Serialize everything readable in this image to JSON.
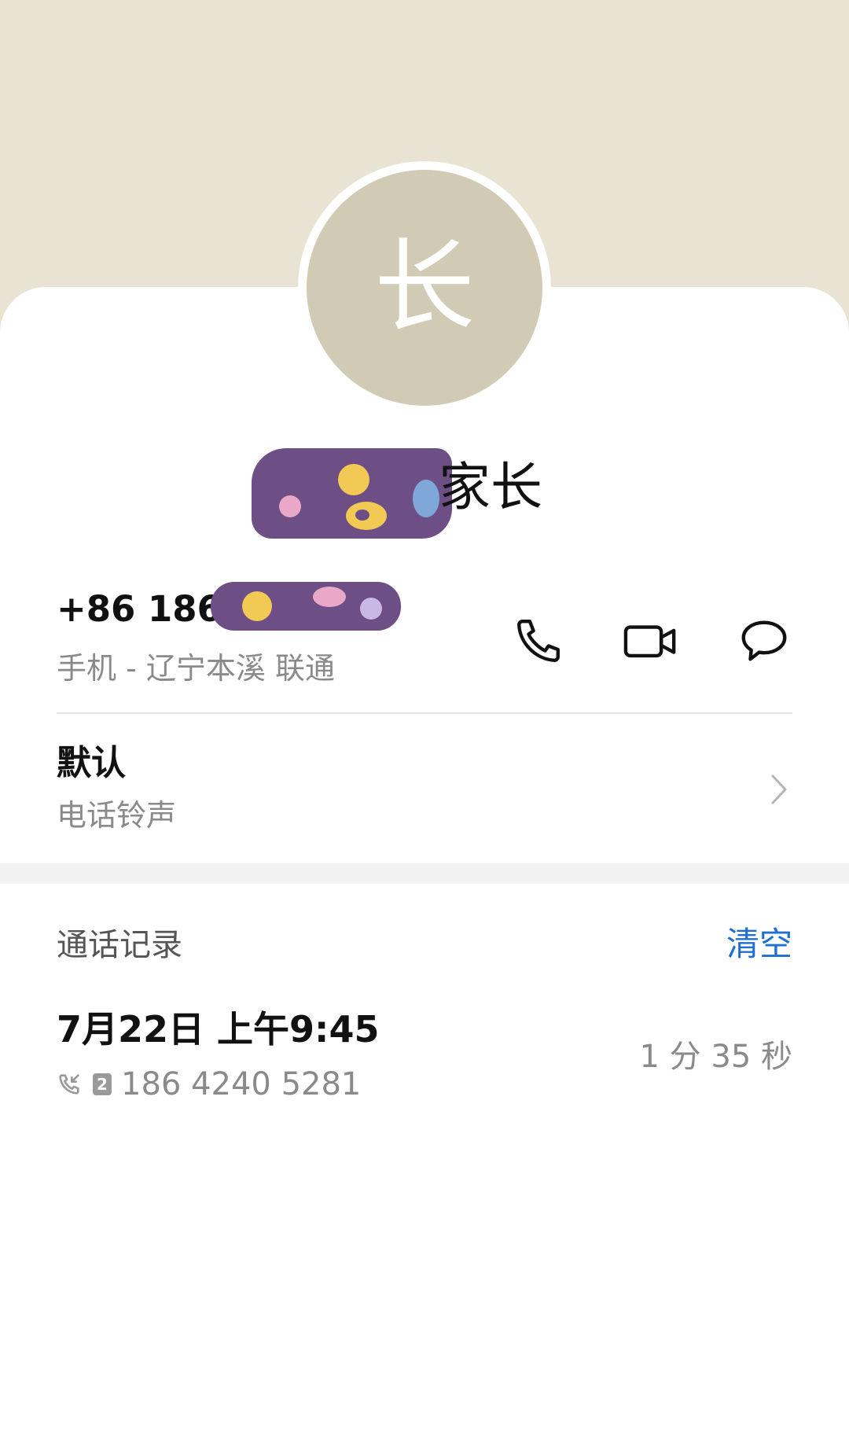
{
  "contact": {
    "avatar_letter": "长",
    "name_visible": "家长"
  },
  "phone": {
    "number_visible": "+86 186 4",
    "subtitle": "手机 - 辽宁本溪 联通"
  },
  "actions": {
    "call_icon": "phone-icon",
    "video_icon": "video-call-icon",
    "message_icon": "message-icon"
  },
  "ringtone": {
    "title": "默认",
    "subtitle": "电话铃声"
  },
  "call_history": {
    "title": "通话记录",
    "clear_label": "清空",
    "entries": [
      {
        "datetime": "7月22日 上午9:45",
        "sim": "2",
        "number": "186 4240 5281",
        "duration": "1 分 35 秒"
      }
    ]
  },
  "colors": {
    "header_bg": "#e8e3d2",
    "avatar_bg": "#d1cbb5",
    "accent": "#1f6fd1",
    "redaction": "#6d4f86"
  }
}
